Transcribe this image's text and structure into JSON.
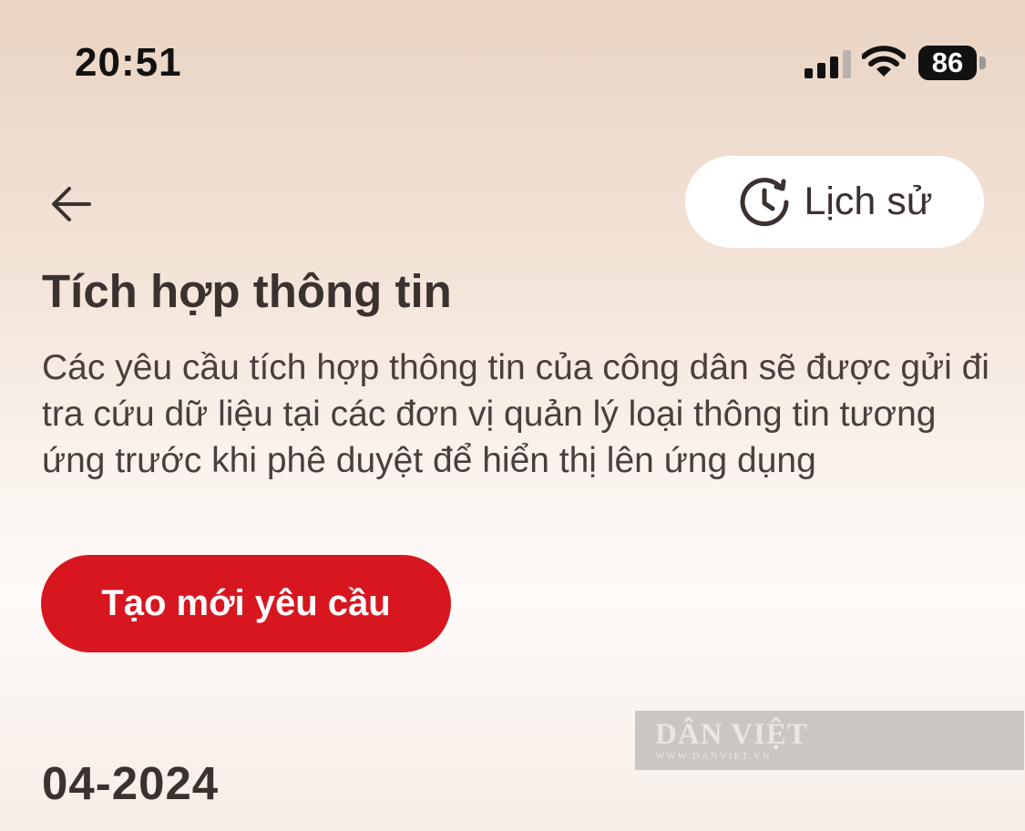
{
  "status_bar": {
    "time": "20:51",
    "battery": "86"
  },
  "header": {
    "history_label": "Lịch sử"
  },
  "page": {
    "title": "Tích hợp thông tin",
    "description": "Các yêu cầu tích hợp thông tin của công dân sẽ được gửi đi tra cứu dữ liệu tại các đơn vị quản lý loại thông tin tương ứng trước khi phê duyệt để hiển thị lên ứng dụng",
    "create_button": "Tạo mới yêu cầu",
    "month": "04-2024"
  },
  "watermark": {
    "brand": "DÂN VIỆT",
    "url": "WWW.DANVIET.VN"
  },
  "colors": {
    "accent": "#d7161f",
    "text": "#3b3230"
  },
  "icons": {
    "back": "arrow-left-icon",
    "history": "clock-history-icon",
    "signal": "signal-icon",
    "wifi": "wifi-icon",
    "battery": "battery-icon"
  }
}
